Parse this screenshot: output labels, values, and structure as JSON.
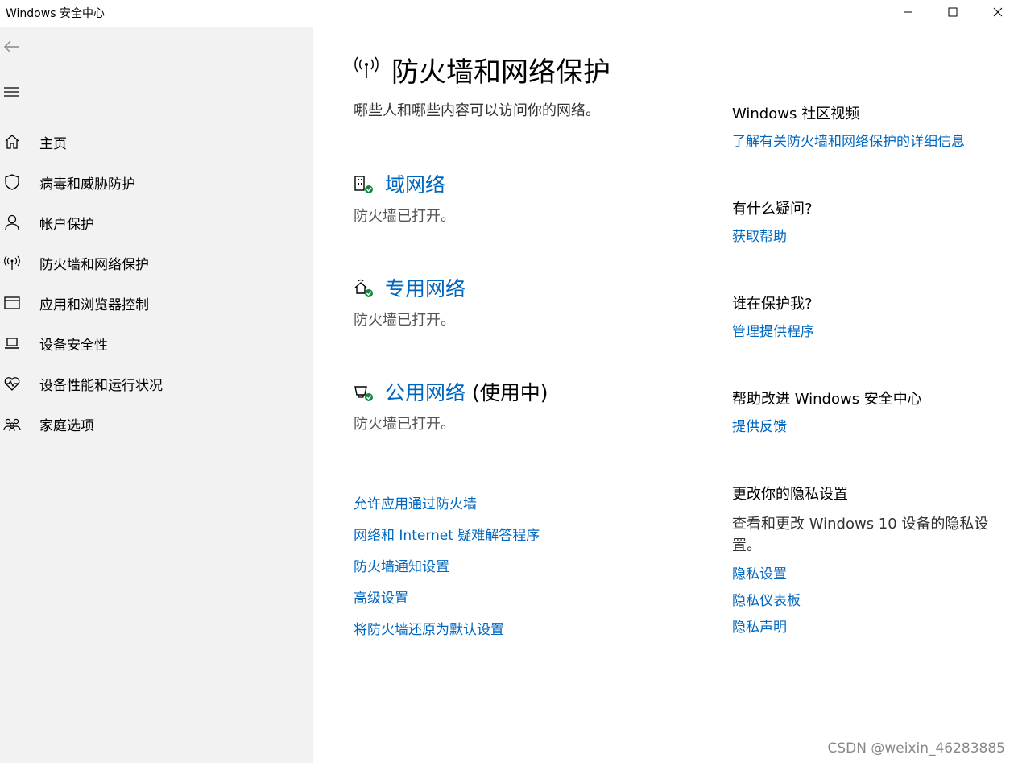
{
  "window": {
    "title": "Windows 安全中心"
  },
  "sidebar": {
    "items": [
      {
        "label": "主页",
        "icon": "home-icon"
      },
      {
        "label": "病毒和威胁防护",
        "icon": "shield-icon"
      },
      {
        "label": "帐户保护",
        "icon": "person-icon"
      },
      {
        "label": "防火墙和网络保护",
        "icon": "antenna-icon"
      },
      {
        "label": "应用和浏览器控制",
        "icon": "browser-window-icon"
      },
      {
        "label": "设备安全性",
        "icon": "laptop-icon"
      },
      {
        "label": "设备性能和运行状况",
        "icon": "heart-pulse-icon"
      },
      {
        "label": "家庭选项",
        "icon": "family-icon"
      }
    ]
  },
  "main": {
    "title": "防火墙和网络保护",
    "subtitle": "哪些人和哪些内容可以访问你的网络。",
    "networks": [
      {
        "name": "域网络",
        "in_use": "",
        "status": "防火墙已打开。",
        "icon": "domain-network-icon"
      },
      {
        "name": "专用网络",
        "in_use": "",
        "status": "防火墙已打开。",
        "icon": "private-network-icon"
      },
      {
        "name": "公用网络",
        "in_use": " (使用中)",
        "status": "防火墙已打开。",
        "icon": "public-network-icon"
      }
    ],
    "links": [
      "允许应用通过防火墙",
      "网络和 Internet 疑难解答程序",
      "防火墙通知设置",
      "高级设置",
      "将防火墙还原为默认设置"
    ]
  },
  "aside": {
    "community": {
      "heading": "Windows 社区视频",
      "link": "了解有关防火墙和网络保护的详细信息"
    },
    "questions": {
      "heading": "有什么疑问?",
      "link": "获取帮助"
    },
    "protector": {
      "heading": "谁在保护我?",
      "link": "管理提供程序"
    },
    "improve": {
      "heading": "帮助改进 Windows 安全中心",
      "link": "提供反馈"
    },
    "privacy": {
      "heading": "更改你的隐私设置",
      "text": "查看和更改 Windows 10 设备的隐私设置。",
      "links": [
        "隐私设置",
        "隐私仪表板",
        "隐私声明"
      ]
    }
  },
  "watermark": "CSDN @weixin_46283885",
  "colors": {
    "accent": "#0067c0",
    "ok_green": "#10893e",
    "sidebar_bg": "#f2f2f2"
  }
}
